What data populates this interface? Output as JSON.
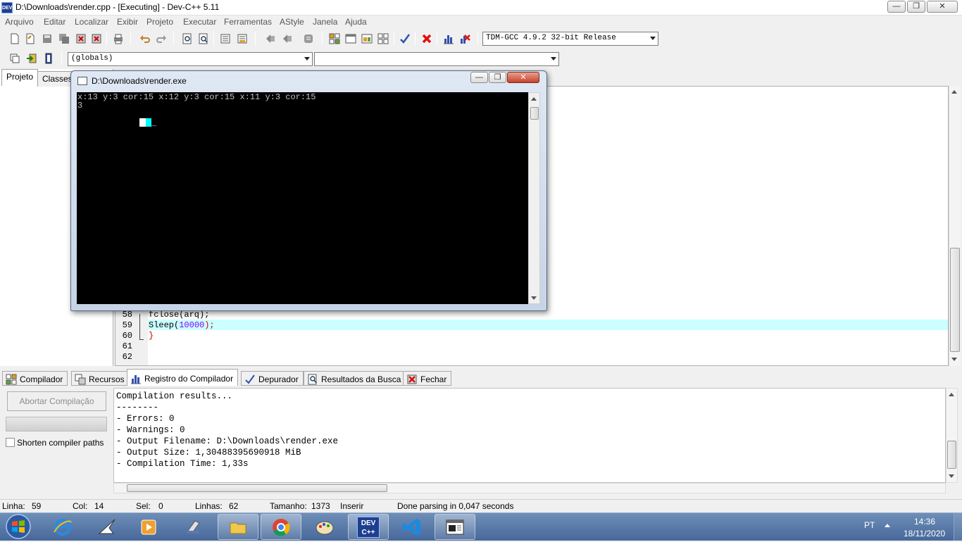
{
  "window": {
    "title": "D:\\Downloads\\render.cpp - [Executing] - Dev-C++ 5.11",
    "app_icon_text": "DEV",
    "minimize": "—",
    "maximize": "❐",
    "close": "✕"
  },
  "menu": [
    "Arquivo",
    "Editar",
    "Localizar",
    "Exibir",
    "Projeto",
    "Executar",
    "Ferramentas",
    "AStyle",
    "Janela",
    "Ajuda"
  ],
  "toolbar": {
    "compiler_select": "TDM-GCC 4.9.2 32-bit Release",
    "scope_select": "(globals)",
    "member_select": ""
  },
  "left_panel": {
    "tabs": [
      "Projeto",
      "Classes"
    ]
  },
  "editor": {
    "lines": [
      {
        "num": "58",
        "code": "fclose(arq);"
      },
      {
        "num": "59",
        "code": "Sleep(10000);"
      },
      {
        "num": "60",
        "code": "}"
      },
      {
        "num": "61",
        "code": ""
      },
      {
        "num": "62",
        "code": ""
      }
    ],
    "sleep_fn": "Sleep(",
    "sleep_num": "10000",
    "sleep_end": ");"
  },
  "console": {
    "title": "D:\\Downloads\\render.exe",
    "lines": [
      "x:13 y:3 cor:15 x:12 y:3 cor:15 x:11 y:3 cor:15",
      "3"
    ],
    "cursor": "_",
    "minimize": "—",
    "maximize": "❐",
    "close": "✕"
  },
  "bottom_tabs": [
    {
      "label": "Compilador",
      "icon": "grid-icon"
    },
    {
      "label": "Recursos",
      "icon": "resources-icon"
    },
    {
      "label": "Registro do Compilador",
      "icon": "chart-icon",
      "active": true
    },
    {
      "label": "Depurador",
      "icon": "check-icon"
    },
    {
      "label": "Resultados da Busca",
      "icon": "search-icon"
    },
    {
      "label": "Fechar",
      "icon": "close-icon"
    }
  ],
  "compiler_panel": {
    "abort_button": "Abortar Compilação",
    "shorten_label": "Shorten compiler paths",
    "log": [
      "Compilation results...",
      "--------",
      "- Errors: 0",
      "- Warnings: 0",
      "- Output Filename: D:\\Downloads\\render.exe",
      "- Output Size: 1,30488395690918 MiB",
      "- Compilation Time: 1,33s"
    ]
  },
  "status": {
    "line_label": "Linha:",
    "line": "59",
    "col_label": "Col:",
    "col": "14",
    "sel_label": "Sel:",
    "sel": "0",
    "lines_label": "Linhas:",
    "lines": "62",
    "size_label": "Tamanho:",
    "size": "1373",
    "mode": "Inserir",
    "message": "Done parsing in 0,047 seconds"
  },
  "taskbar": {
    "lang": "PT",
    "time": "14:36",
    "date": "18/11/2020",
    "devcpp_label": "DEV\nC++"
  }
}
